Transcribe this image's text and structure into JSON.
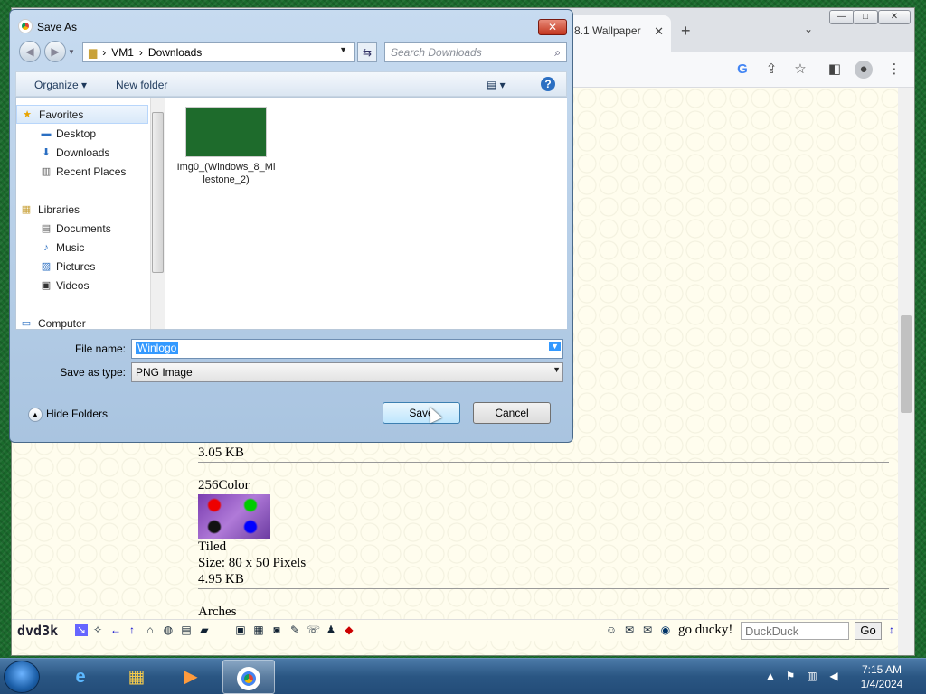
{
  "browser": {
    "tab_title": "8.1 Wallpaper",
    "tab_close": "✕",
    "new_tab": "+",
    "tab_menu": "⌄",
    "win_min": "—",
    "win_max": "□",
    "win_close": "✕",
    "toolbar_icons": [
      "google-icon",
      "share-icon",
      "star-icon",
      "sidepanel-icon",
      "profile-icon",
      "menu-icon"
    ]
  },
  "page": {
    "size_partial": "3.05 KB",
    "item_name": "256Color",
    "item_mode": "Tiled",
    "item_size": "Size: 80 x 50 Pixels",
    "item_filesize": "4.95 KB",
    "next_item": "Arches"
  },
  "bottom_bar": {
    "logo": "dvd3k",
    "ducky_label": "go ducky!",
    "search_placeholder": "DuckDuck",
    "go_label": "Go"
  },
  "dialog": {
    "title": "Save As",
    "close": "✕",
    "path": [
      "VM1",
      "Downloads"
    ],
    "search_placeholder": "Search Downloads",
    "organize": "Organize",
    "new_folder": "New folder",
    "nav": {
      "favorites": "Favorites",
      "desktop": "Desktop",
      "downloads": "Downloads",
      "recent": "Recent Places",
      "libraries": "Libraries",
      "documents": "Documents",
      "music": "Music",
      "pictures": "Pictures",
      "videos": "Videos",
      "computer": "Computer"
    },
    "file": {
      "name": "Img0_(Windows_8_Milestone_2)"
    },
    "file_name_label": "File name:",
    "file_name_value": "Winlogo",
    "save_type_label": "Save as type:",
    "save_type_value": "PNG Image",
    "hide_folders": "Hide Folders",
    "save": "Save",
    "cancel": "Cancel"
  },
  "taskbar": {
    "time": "7:15 AM",
    "date": "1/4/2024"
  }
}
